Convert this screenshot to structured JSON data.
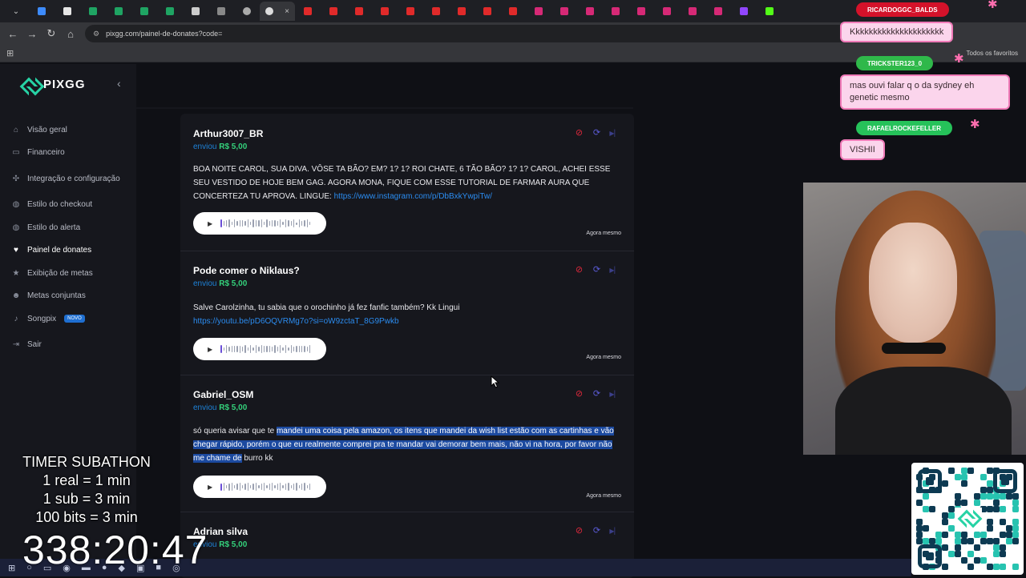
{
  "browser": {
    "url": "pixgg.com/painel-de-donates?code=",
    "bookmarks_all": "Todos os favoritos",
    "tab_close": "×"
  },
  "sidebar": {
    "logo": "PIXGG",
    "items": [
      {
        "label": "Visão geral",
        "icon": "home-icon"
      },
      {
        "label": "Financeiro",
        "icon": "wallet-icon"
      },
      {
        "label": "Integração e configuração",
        "icon": "puzzle-icon"
      },
      {
        "label": "Estilo do checkout",
        "icon": "palette-icon"
      },
      {
        "label": "Estilo do alerta",
        "icon": "palette-icon"
      },
      {
        "label": "Painel de donates",
        "icon": "donate-icon"
      },
      {
        "label": "Exibição de metas",
        "icon": "star-icon"
      },
      {
        "label": "Metas conjuntas",
        "icon": "users-icon"
      },
      {
        "label": "Songpix",
        "icon": "music-icon",
        "badge": "NOVO"
      },
      {
        "label": "Sair",
        "icon": "logout-icon"
      }
    ]
  },
  "donations": [
    {
      "name": "Arthur3007_BR",
      "sent_label": "enviou",
      "amount": "R$ 5,00",
      "message": "BOA NOITE CAROL, SUA DIVA. VÔSE TA BÃO? EM? 1? 1? ROI CHATE, 6 TÃO BÃO? 1? 1? CAROL, ACHEI ESSE SEU VESTIDO DE HOJE BEM GAG. AGORA MONA, FIQUE COM ESSE TUTORIAL DE FARMAR AURA QUE CONCERTEZA TU APROVA. LINGUE: ",
      "link": "https://www.instagram.com/p/DbBxkYwpiTw/",
      "time": "Agora mesmo"
    },
    {
      "name": "Pode comer o Niklaus?",
      "sent_label": "enviou",
      "amount": "R$ 5,00",
      "message": "Salve Carolzinha, tu sabia que o orochinho já fez fanfic também? Kk Lingui",
      "link": "https://youtu.be/pD6OQVRMg7o?si=oW9zctaT_8G9Pwkb",
      "time": "Agora mesmo"
    },
    {
      "name": "Gabriel_OSM",
      "sent_label": "enviou",
      "amount": "R$ 5,00",
      "message_pre": "só queria avisar que te ",
      "message_hl": "mandei uma coisa pela amazon, os itens que mandei da wish list estão com as cartinhas e vão chegar rápido, porém o que eu realmente comprei pra te mandar vai demorar bem mais, não vi na hora, por favor não me chame de",
      "message_post": " burro kk",
      "time": "Agora mesmo"
    },
    {
      "name": "Adrian silva",
      "sent_label": "enviou",
      "amount": "R$ 5,00"
    }
  ],
  "chat": [
    {
      "user": "RICARDOGGC_BALDS",
      "message": "Kkkkkkkkkkkkkkkkkkkkk",
      "name_color": "#e0142c"
    },
    {
      "user": "TRICKSTER123_0",
      "message": "mas ouvi falar q o da sydney eh genetic mesmo",
      "name_color": "#2fb84a"
    },
    {
      "user": "RAFAELROCKEFELLER",
      "message": "VISHII",
      "name_color": "#26c25a"
    }
  ],
  "overlay": {
    "timer_title": "TIMER SUBATHON",
    "timer_lines": [
      "1 real = 1 min",
      "1 sub = 3 min",
      "100 bits = 3 min"
    ],
    "timer_value": "338:20:47"
  }
}
